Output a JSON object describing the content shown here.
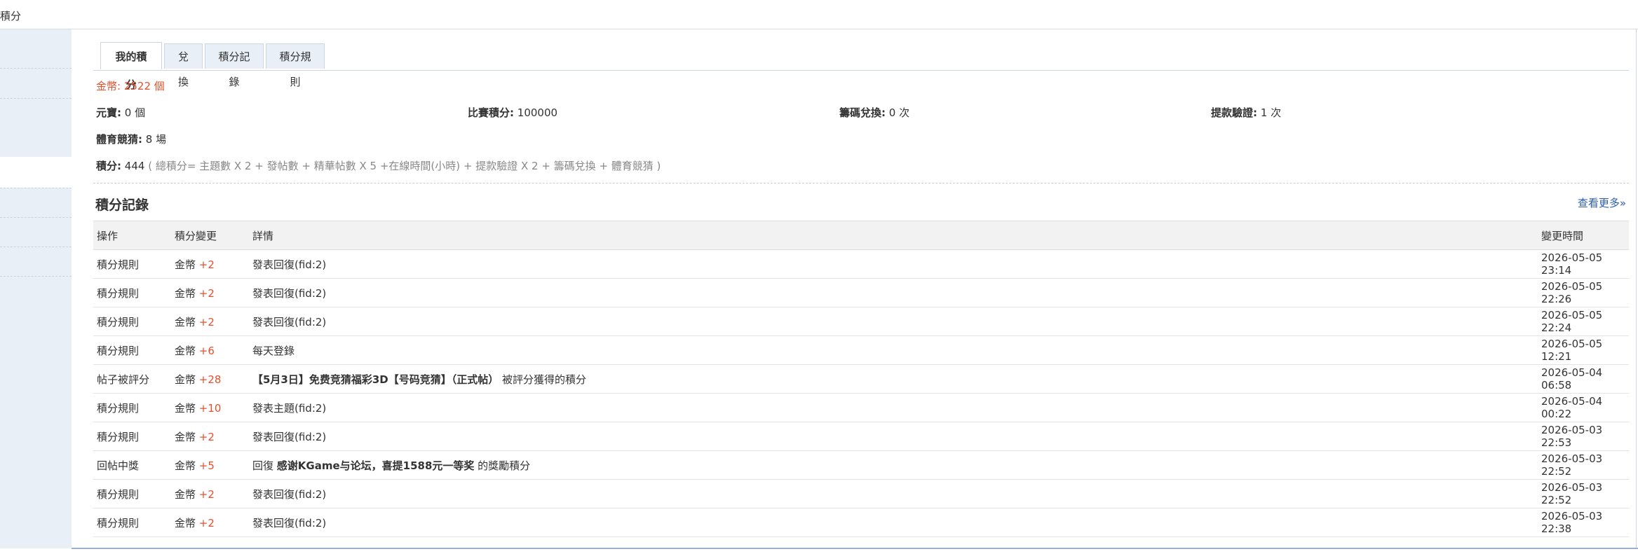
{
  "page": {
    "title": "積分"
  },
  "tabs": [
    {
      "label": "我的積分",
      "active": true
    },
    {
      "label": "兌換",
      "active": false
    },
    {
      "label": "積分記錄",
      "active": false
    },
    {
      "label": "積分規則",
      "active": false
    }
  ],
  "summary": {
    "gold_label": "金幣:",
    "gold_value": "2522 個",
    "yuanbao_label": "元寶:",
    "yuanbao_value": "0 個",
    "match_label": "比賽積分:",
    "match_value": "100000",
    "chip_label": "籌碼兌換:",
    "chip_value": "0 次",
    "withdraw_label": "提款驗證:",
    "withdraw_value": "1 次",
    "sports_label": "體育競猜:",
    "sports_value": "8 場",
    "points_label": "積分:",
    "points_value": "444",
    "points_formula": "( 總積分= 主題數 X 2 + 發帖數 + 精華帖數 X 5 +在線時間(小時) + 提款驗證 X 2 + 籌碼兌換 + 體育競猜 )"
  },
  "records": {
    "title": "積分記錄",
    "more_label": "查看更多»",
    "columns": [
      "操作",
      "積分變更",
      "詳情",
      "變更時間"
    ],
    "rows": [
      {
        "op": "積分規則",
        "currency": "金幣",
        "delta": "+2",
        "detail_prefix": "發表回復(fid:2)",
        "detail_bold": "",
        "detail_suffix": "",
        "time": "2026-05-05 23:14"
      },
      {
        "op": "積分規則",
        "currency": "金幣",
        "delta": "+2",
        "detail_prefix": "發表回復(fid:2)",
        "detail_bold": "",
        "detail_suffix": "",
        "time": "2026-05-05 22:26"
      },
      {
        "op": "積分規則",
        "currency": "金幣",
        "delta": "+2",
        "detail_prefix": "發表回復(fid:2)",
        "detail_bold": "",
        "detail_suffix": "",
        "time": "2026-05-05 22:24"
      },
      {
        "op": "積分規則",
        "currency": "金幣",
        "delta": "+6",
        "detail_prefix": "每天登錄",
        "detail_bold": "",
        "detail_suffix": "",
        "time": "2026-05-05 12:21"
      },
      {
        "op": "帖子被評分",
        "currency": "金幣",
        "delta": "+28",
        "detail_prefix": "",
        "detail_bold": "【5月3日】免费竞猜福彩3D【号码竞猜】（正式帖）",
        "detail_suffix": " 被評分獲得的積分",
        "time": "2026-05-04 06:58"
      },
      {
        "op": "積分規則",
        "currency": "金幣",
        "delta": "+10",
        "detail_prefix": "發表主題(fid:2)",
        "detail_bold": "",
        "detail_suffix": "",
        "time": "2026-05-04 00:22"
      },
      {
        "op": "積分規則",
        "currency": "金幣",
        "delta": "+2",
        "detail_prefix": "發表回復(fid:2)",
        "detail_bold": "",
        "detail_suffix": "",
        "time": "2026-05-03 22:53"
      },
      {
        "op": "回帖中獎",
        "currency": "金幣",
        "delta": "+5",
        "detail_prefix": "回復 ",
        "detail_bold": "感谢KGame与论坛，喜提1588元一等奖",
        "detail_suffix": " 的獎勵積分",
        "time": "2026-05-03 22:52"
      },
      {
        "op": "積分規則",
        "currency": "金幣",
        "delta": "+2",
        "detail_prefix": "發表回復(fid:2)",
        "detail_bold": "",
        "detail_suffix": "",
        "time": "2026-05-03 22:52"
      },
      {
        "op": "積分規則",
        "currency": "金幣",
        "delta": "+2",
        "detail_prefix": "發表回復(fid:2)",
        "detail_bold": "",
        "detail_suffix": "",
        "time": "2026-05-03 22:38"
      }
    ]
  }
}
